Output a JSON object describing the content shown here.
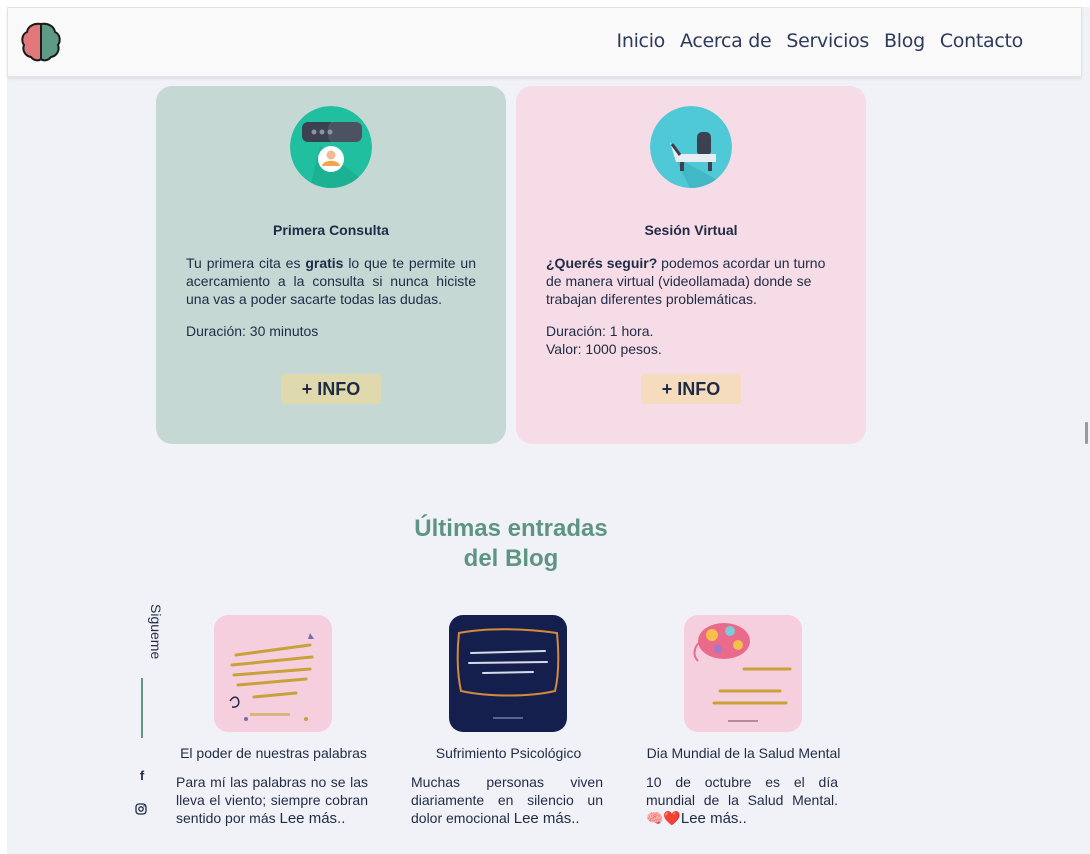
{
  "nav": {
    "items": [
      "Inicio",
      "Acerca de",
      "Servicios",
      "Blog",
      "Contacto"
    ]
  },
  "icons": {
    "logo": "brain-logo-icon",
    "consult": "chat-bubbles-person-icon",
    "virtual": "chair-icon",
    "facebook": "facebook-icon",
    "instagram": "instagram-icon"
  },
  "colors": {
    "green_card": "#c5d8d4",
    "pink_card": "#f5dce6",
    "accent": "#5e9582",
    "text": "#1f2b45"
  },
  "services": [
    {
      "title": "Primera Consulta",
      "text_pre": "Tu primera cita es ",
      "text_bold": "gratis",
      "text_post": " lo que te permite un acercamiento a la consulta si nunca hiciste una vas a poder sacarte todas las dudas.",
      "duration": "Duración: 30 minutos",
      "button": "+ INFO"
    },
    {
      "title": "Sesión Virtual",
      "text_bold": "¿Querés seguir?",
      "text_post": " podemos acordar un turno de manera virtual (videollamada) donde se trabajan diferentes problemáticas.",
      "duration": "Duración: 1 hora.",
      "price": "Valor: 1000 pesos.",
      "button": "+ INFO"
    }
  ],
  "blog": {
    "heading_line1": "Últimas entradas",
    "heading_line2": "del Blog",
    "posts": [
      {
        "title": "El poder de nuestras palabras",
        "excerpt": "Para mí las palabras no se las lleva el viento; siempre cobran sentido por más",
        "more": "Lee más.."
      },
      {
        "title": "Sufrimiento Psicológico",
        "excerpt": "Muchas personas viven diariamente en silencio un dolor emocional",
        "more": "Lee más.."
      },
      {
        "title": "Dia Mundial de la Salud Mental",
        "excerpt": "10 de octubre es el día mundial de la Salud Mental.",
        "emoji": "🧠❤️",
        "more": "Lee más.."
      }
    ]
  },
  "social": {
    "label": "Sigueme",
    "facebook_glyph": "f"
  }
}
